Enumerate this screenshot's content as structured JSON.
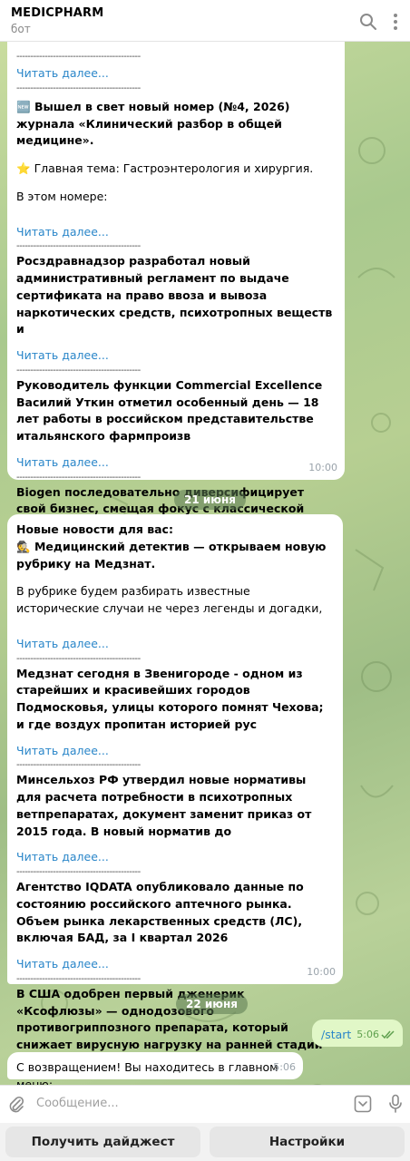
{
  "header": {
    "title": "MEDICPHARM",
    "subtitle": "бот"
  },
  "msg1": {
    "read_more": "Читать далее...",
    "sep": "--------------------------------------------",
    "p1_emoji": "🆕",
    "p1": "Вышел в свет новый номер (№4, 2026) журнала «Клинический разбор в общей медицине».",
    "p2_emoji": "⭐",
    "p2": "Главная тема: Гастроэнтерология и хирургия.",
    "p3": "В этом номере:",
    "n2": "Росздравнадзор разработал новый административный регламент по выдаче сертификата на право ввоза и вывоза наркотических средств, психотропных веществ и",
    "n3": "Руководитель функции Commercial Excellence Василий Уткин отметил особенный день — 18 лет работы в российском представительстве итальянского фармпроизв",
    "n4": "Biogen последовательно диверсифицирует свой бизнес, смещая фокус с классической неврологии в сторону специализированной иммунологии. Фармкорпорация со",
    "time": "10:00"
  },
  "date1": "21 июня",
  "msg2": {
    "intro": "Новые новости для вас:",
    "d_emoji": "🕵️",
    "d1": "Медицинский детектив — открываем новую рубрику на Медзнат.",
    "d2": "В рубрике будем разбирать известные исторические случаи не через легенды и догадки,",
    "n2": "Медзнат сегодня в Звенигороде - одном из старейших и красивейших городов Подмосковья, улицы которого помнят Чехова; и где воздух пропитан историей рус",
    "n3": "Минсельхоз РФ утвердил новые нормативы для расчета потребности в психотропных ветпрепаратах, документ заменит приказ от 2015 года. В новый норматив до",
    "n4": "Агентство IQDATA опубликовало данные по состоянию российского аптечного рынка. Объем рынка лекарственных средств (ЛС), включая БАД, за I квартал 2026",
    "n5": "В США одобрен первый дженерик «Ксофлюзы» — однодозового противогриппозного препарата, который снижает вирусную нагрузку на ранней стадии заражения. Пр",
    "time": "10:00"
  },
  "date2": "22 июня",
  "outgoing": {
    "text": "/start",
    "time": "5:06"
  },
  "reply": {
    "text": "С возвращением! Вы находитесь в главном меню:",
    "time": "5:06"
  },
  "input": {
    "placeholder": "Сообщение..."
  },
  "keyboard": {
    "btn1": "Получить дайджест",
    "btn2": "Настройки"
  },
  "colors": {
    "link": "#2a86c9",
    "outgoing_bubble": "#e1f7c7",
    "check": "#5fa04e"
  }
}
